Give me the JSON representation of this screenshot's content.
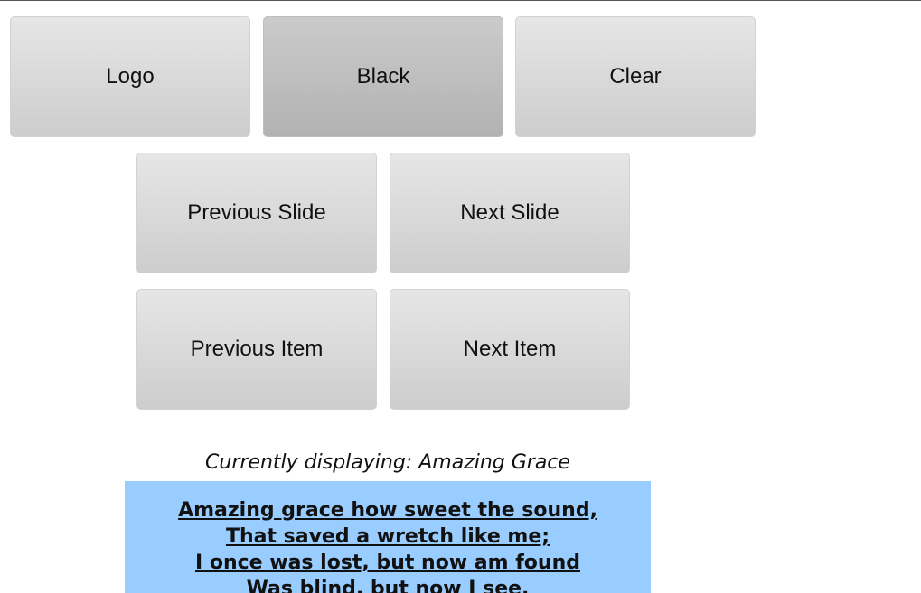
{
  "controls": {
    "logo_label": "Logo",
    "black_label": "Black",
    "clear_label": "Clear",
    "previous_slide_label": "Previous Slide",
    "next_slide_label": "Next Slide",
    "previous_item_label": "Previous Item",
    "next_item_label": "Next Item"
  },
  "current": {
    "text": "Currently displaying: Amazing Grace"
  },
  "slide": {
    "lines": [
      "Amazing grace how sweet the sound,",
      "That saved a wretch like me;",
      "I once was lost, but now am found",
      "Was blind, but now I see."
    ],
    "background": "#99ccff"
  },
  "colors": {
    "button_top": "#e6e6e6",
    "button_bottom": "#cdcdcd",
    "active_button_top": "#cbcbcb",
    "active_button_bottom": "#b2b2b2"
  }
}
